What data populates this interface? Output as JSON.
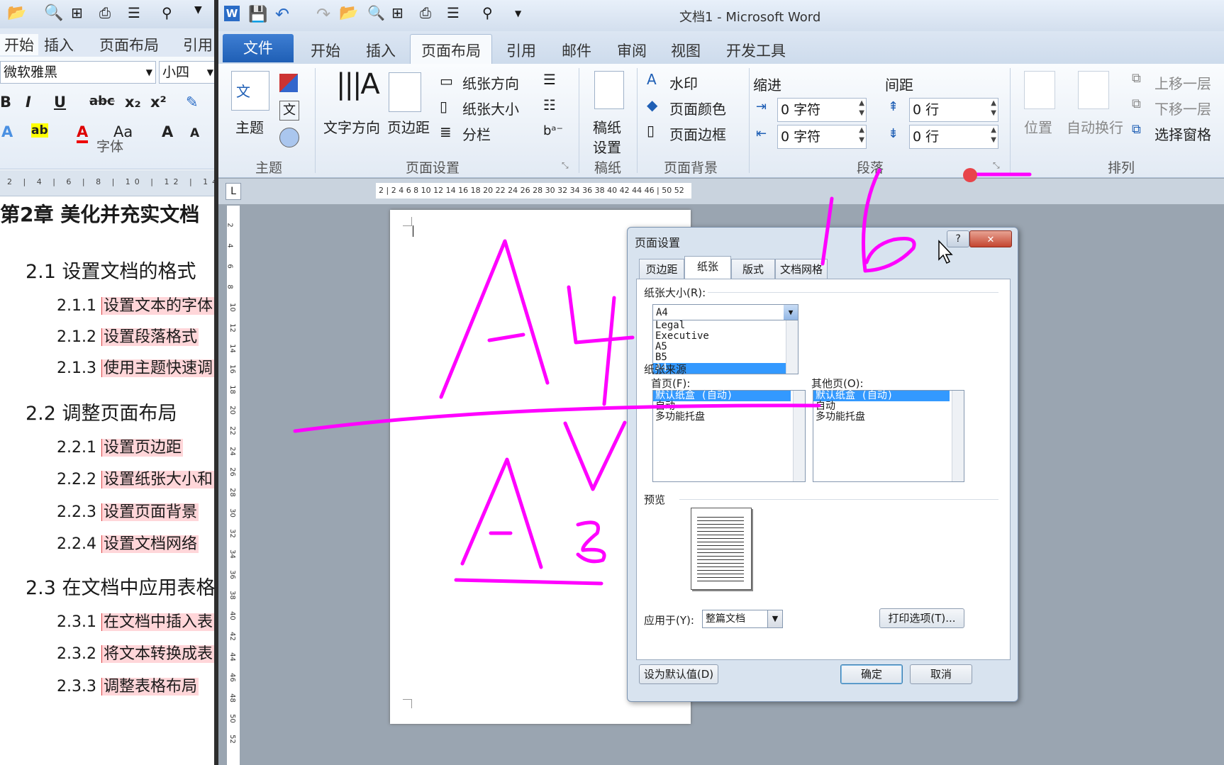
{
  "left_window": {
    "tabs": [
      "开始",
      "插入",
      "页面布局",
      "引用"
    ],
    "font_name": "微软雅黑",
    "font_size": "小四",
    "format_icons": [
      "B",
      "I",
      "U",
      "abc",
      "x₂",
      "x²"
    ],
    "font_group_label": "字体",
    "ruler_text": "2 | 4 | 6 | 8 | 10 | 12 | 14",
    "toc": [
      {
        "text": "第2章  美化并充实文档",
        "level": 1
      },
      {
        "text": "2.1   设置文档的格式",
        "level": 2
      },
      {
        "num": "2.1.1",
        "text": "设置文本的字体",
        "level": 3
      },
      {
        "num": "2.1.2",
        "text": "设置段落格式",
        "level": 3
      },
      {
        "num": "2.1.3",
        "text": "使用主题快速调",
        "level": 3
      },
      {
        "text": "2.2   调整页面布局",
        "level": 2
      },
      {
        "num": "2.2.1",
        "text": "设置页边距",
        "level": 3
      },
      {
        "num": "2.2.2",
        "text": "设置纸张大小和",
        "level": 3
      },
      {
        "num": "2.2.3",
        "text": "设置页面背景",
        "level": 3
      },
      {
        "num": "2.2.4",
        "text": "设置文档网络",
        "level": 3
      },
      {
        "text": "2.3   在文档中应用表格",
        "level": 2
      },
      {
        "num": "2.3.1",
        "text": "在文档中插入表",
        "level": 3
      },
      {
        "num": "2.3.2",
        "text": "将文本转换成表",
        "level": 3
      },
      {
        "num": "2.3.3",
        "text": "调整表格布局",
        "level": 3
      }
    ]
  },
  "main_window": {
    "title": "文档1 - Microsoft Word",
    "file_tab": "文件",
    "tabs": [
      "开始",
      "插入",
      "页面布局",
      "引用",
      "邮件",
      "审阅",
      "视图",
      "开发工具"
    ],
    "active_tab": "页面布局",
    "ribbon": {
      "theme": {
        "btn": "主题",
        "group": "主题"
      },
      "page_setup": {
        "text_direction": "文字方向",
        "margins": "页边距",
        "orientation": "纸张方向",
        "size": "纸张大小",
        "columns": "分栏",
        "group": "页面设置"
      },
      "draft": {
        "btn1": "稿纸",
        "btn2": "设置",
        "group": "稿纸"
      },
      "background": {
        "watermark": "水印",
        "page_color": "页面颜色",
        "page_border": "页面边框",
        "group": "页面背景"
      },
      "paragraph": {
        "indent_label": "缩进",
        "spacing_label": "间距",
        "indent_left": "0 字符",
        "indent_right": "0 字符",
        "spacing_before": "0 行",
        "spacing_after": "0 行",
        "group": "段落"
      },
      "arrange": {
        "position": "位置",
        "wrap": "自动换行",
        "bring_forward": "上移一层",
        "send_backward": "下移一层",
        "selection_pane": "选择窗格",
        "group": "排列"
      }
    },
    "ruler_numbers": "2 | 2 4 6 8 10 12 14 16 18 20 22 24 26 28 30 32 34 36 38 40 42 44 46 | 50 52",
    "vruler_numbers": [
      "2",
      "4",
      "6",
      "8",
      "10",
      "12",
      "14",
      "16",
      "18",
      "20",
      "22",
      "24",
      "26",
      "28",
      "30",
      "32",
      "34",
      "36",
      "38",
      "40",
      "42",
      "44",
      "46",
      "48",
      "50",
      "52"
    ]
  },
  "dialog": {
    "title": "页面设置",
    "help": "?",
    "close": "✕",
    "tabs": [
      "页边距",
      "纸张",
      "版式",
      "文档网格"
    ],
    "active_tab": "纸张",
    "paper_size_label": "纸张大小(R):",
    "paper_size_value": "A4",
    "paper_options": [
      "Legal",
      "Executive",
      "A5",
      "B5",
      "A4"
    ],
    "paper_source_label": "纸张来源",
    "first_page_label": "首页(F):",
    "other_pages_label": "其他页(O):",
    "first_page_options": [
      "默认纸盒 (自动)",
      "自动",
      "多功能托盘"
    ],
    "other_pages_options": [
      "默认纸盒 (自动)",
      "自动",
      "多功能托盘"
    ],
    "preview_label": "预览",
    "apply_to_label": "应用于(Y):",
    "apply_to_value": "整篇文档",
    "print_options": "打印选项(T)...",
    "set_default": "设为默认值(D)",
    "ok": "确定",
    "cancel": "取消"
  },
  "annotations": {
    "color": "#ff00ff",
    "texts": [
      "A4",
      "A3",
      "16"
    ]
  },
  "colors": {
    "file_tab": "#2a6cc6",
    "selection": "#3399ff",
    "annotation": "#ff00ff"
  }
}
